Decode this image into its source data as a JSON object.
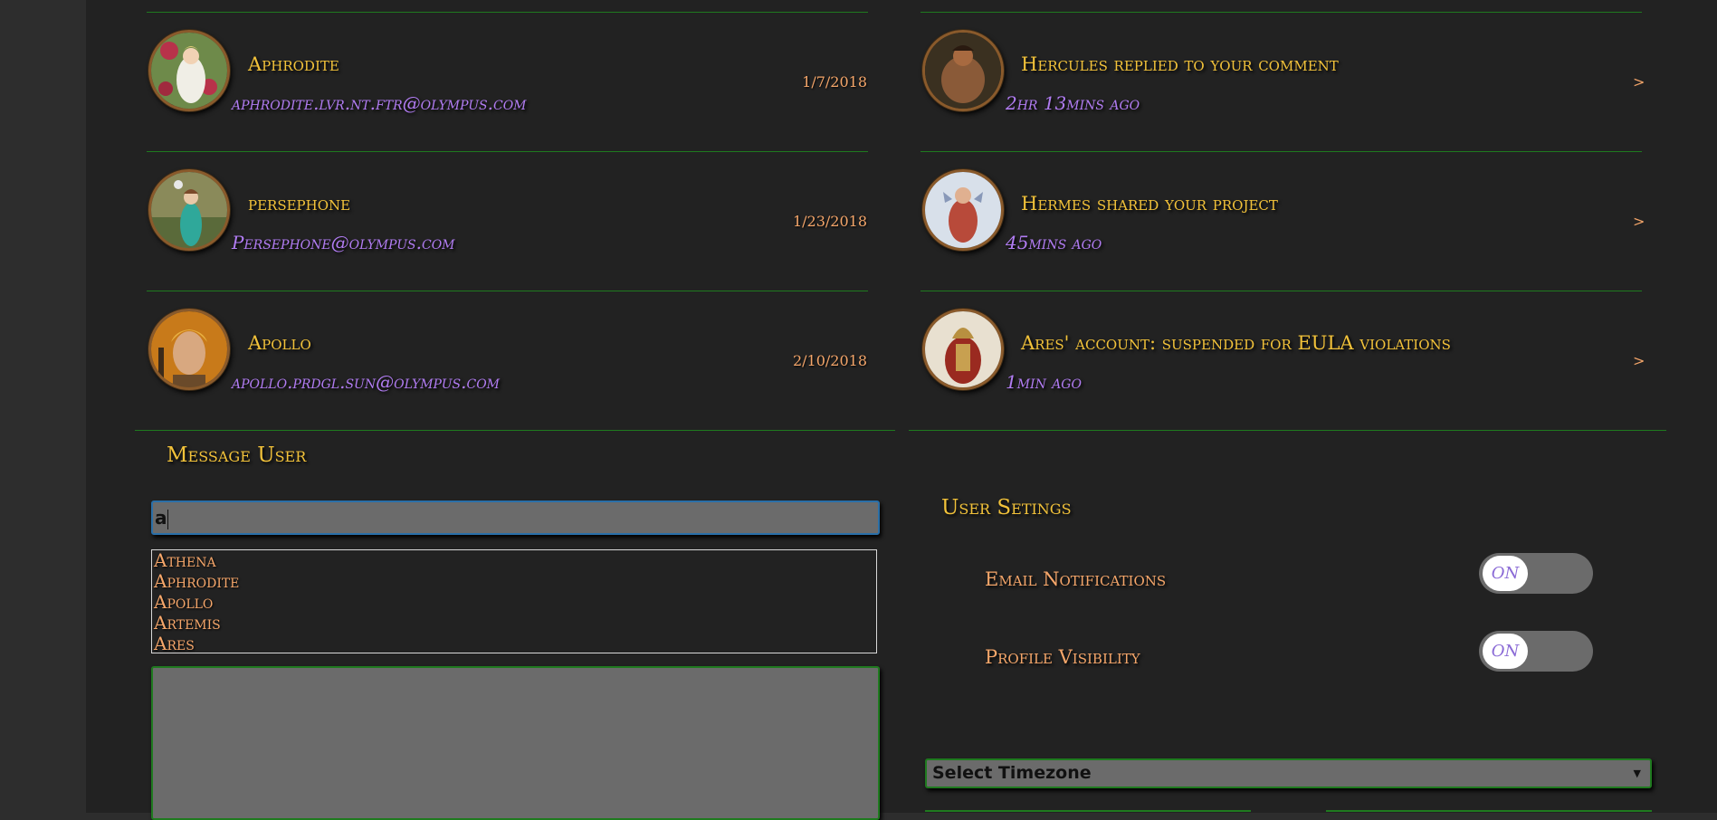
{
  "users": [
    {
      "name": "Aphrodite",
      "email": "aphrodite.lvr.nt.ftr@olympus.com",
      "date": "1/7/2018"
    },
    {
      "name": "persephone",
      "email": "Persephone@olympus.com",
      "date": "1/23/2018"
    },
    {
      "name": "Apollo",
      "email": "apollo.prdgl.sun@olympus.com",
      "date": "2/10/2018"
    }
  ],
  "notifications": [
    {
      "text": "Hercules replied to your comment",
      "time": "2hr 13mins ago",
      "arrow": ">"
    },
    {
      "text": "Hermes shared your project",
      "time": "45mins ago",
      "arrow": ">"
    },
    {
      "text": "Ares' account: suspended for EULA violations",
      "time": "1min ago",
      "arrow": ">"
    }
  ],
  "message": {
    "title": "Message User",
    "search_value": "a",
    "suggestions": [
      "Athena",
      "Aphrodite",
      "Apollo",
      "Artemis",
      "Ares"
    ]
  },
  "settings": {
    "title": "User Setings",
    "email_label": "Email Notifications",
    "email_toggle": "ON",
    "visibility_label": "Profile Visibility",
    "visibility_toggle": "ON",
    "timezone_placeholder": "Select Timezone"
  },
  "colors": {
    "name": "#f2c23a",
    "email": "#b17cf2",
    "date": "#f5a66a",
    "divider": "#1f7a1f",
    "panel": "#222222"
  }
}
